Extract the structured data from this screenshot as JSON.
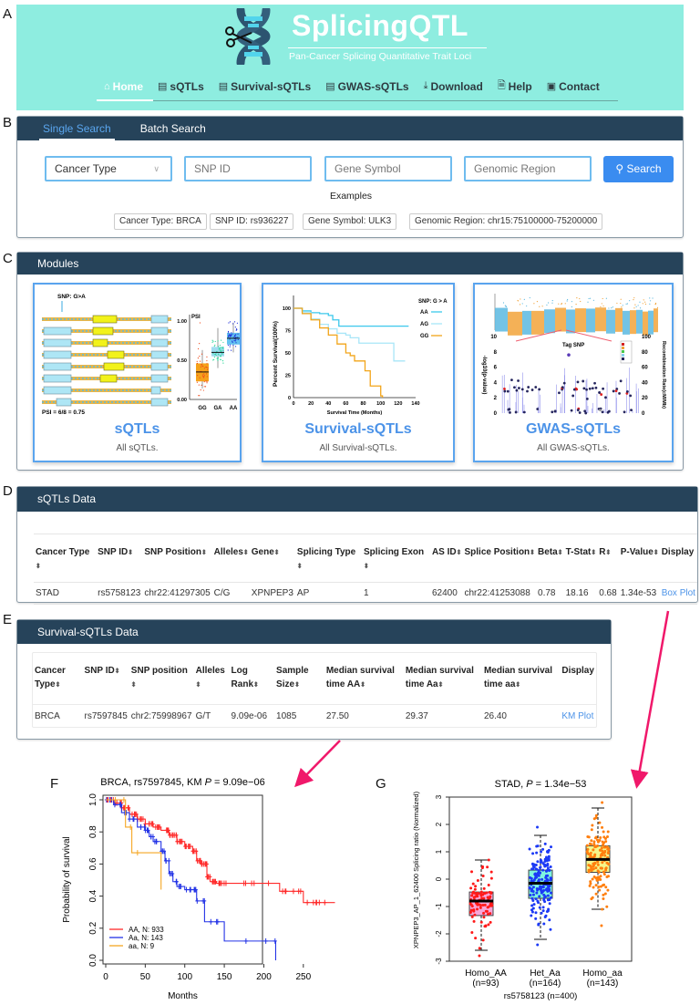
{
  "panel_labels": [
    "A",
    "B",
    "C",
    "D",
    "E",
    "F",
    "G"
  ],
  "header": {
    "title": "SplicingQTL",
    "subtitle": "Pan-Cancer Splicing Quantitative Trait Loci",
    "logo_icon": "dna-scissors-icon",
    "colors": {
      "background": "#8eede0",
      "text": "#ffffff",
      "nav_text": "#2e3a40"
    },
    "nav": [
      {
        "label": "Home",
        "icon": "home-icon",
        "active": true
      },
      {
        "label": "sQTLs",
        "icon": "table-icon",
        "active": false
      },
      {
        "label": "Survival-sQTLs",
        "icon": "table-icon",
        "active": false
      },
      {
        "label": "GWAS-sQTLs",
        "icon": "table-icon",
        "active": false
      },
      {
        "label": "Download",
        "icon": "download-icon",
        "active": false
      },
      {
        "label": "Help",
        "icon": "help-doc-icon",
        "active": false
      },
      {
        "label": "Contact",
        "icon": "contact-book-icon",
        "active": false
      }
    ]
  },
  "search": {
    "tabs": [
      {
        "label": "Single Search",
        "active": true
      },
      {
        "label": "Batch Search",
        "active": false
      }
    ],
    "cancer_type": {
      "value": "Cancer Type"
    },
    "snp_id": {
      "placeholder": "SNP ID"
    },
    "gene_symbol": {
      "placeholder": "Gene Symbol"
    },
    "genomic_region": {
      "placeholder": "Genomic Region"
    },
    "button_label": "Search",
    "examples_label": "Examples",
    "examples": [
      "Cancer Type: BRCA",
      "SNP ID: rs936227",
      "Gene Symbol: ULK3",
      "Genomic Region: chr15:75100000-75200000"
    ],
    "colors": {
      "header_bar": "#26435a",
      "button": "#3a8cf0",
      "field_border": "#6fbcef"
    }
  },
  "modules": {
    "title": "Modules",
    "cards": [
      {
        "title": "sQTLs",
        "description": "All sQTLs.",
        "thumb": {
          "snp_label": "SNP: G>A",
          "psi_formula": "PSI = 6/8 = 0.75",
          "y_label": "PSI",
          "y_ticks": [
            "0.00",
            "0.50",
            "1.00"
          ],
          "groups": [
            "GG",
            "GA",
            "AA"
          ]
        }
      },
      {
        "title": "Survival-sQTLs",
        "description": "All Survival-sQTLs.",
        "thumb": {
          "legend_title": "SNP: G > A",
          "legend": [
            "AA",
            "AG",
            "GG"
          ],
          "y_label": "Percent Survival(100%)",
          "x_label": "Survival Time (Months)",
          "y_ticks": [
            "0",
            "25",
            "50",
            "75",
            "100"
          ],
          "x_ticks": [
            "0",
            "20",
            "40",
            "60",
            "80",
            "100",
            "120",
            "140"
          ]
        }
      },
      {
        "title": "GWAS-sQTLs",
        "description": "All GWAS-sQTLs.",
        "thumb": {
          "annotation": "Tag SNP",
          "y_label": "-log10(p-value)",
          "y2_label": "Recombination Rate(cM/Mb)",
          "y_ticks": [
            "0",
            "2",
            "4",
            "6",
            "8",
            "10"
          ],
          "y2_ticks": [
            "0",
            "20",
            "40",
            "60",
            "80",
            "100"
          ]
        }
      }
    ]
  },
  "sqtls_table": {
    "title": "sQTLs Data",
    "columns": [
      {
        "label": "Cancer Type",
        "sortable": true
      },
      {
        "label": "SNP ID",
        "sortable": true
      },
      {
        "label": "SNP Position",
        "sortable": true
      },
      {
        "label": "Alleles",
        "sortable": true
      },
      {
        "label": "Gene",
        "sortable": true
      },
      {
        "label": "Splicing Type",
        "sortable": true
      },
      {
        "label": "Splicing Exon",
        "sortable": true
      },
      {
        "label": "AS ID",
        "sortable": true
      },
      {
        "label": "Splice Position",
        "sortable": true
      },
      {
        "label": "Beta",
        "sortable": true
      },
      {
        "label": "T-Stat",
        "sortable": true
      },
      {
        "label": "R",
        "sortable": true
      },
      {
        "label": "P-Value",
        "sortable": true
      },
      {
        "label": "Display",
        "sortable": false
      }
    ],
    "rows": [
      [
        "STAD",
        "rs5758123",
        "chr22:41297305",
        "C/G",
        "XPNPEP3",
        "AP",
        "1",
        "62400",
        "chr22:41253088",
        "0.78",
        "18.16",
        "0.68",
        "1.34e-53",
        "Box Plot"
      ]
    ]
  },
  "survival_table": {
    "title": "Survival-sQTLs Data",
    "columns": [
      {
        "label": "Cancer Type",
        "sortable": true
      },
      {
        "label": "SNP ID",
        "sortable": true
      },
      {
        "label": "SNP position",
        "sortable": true
      },
      {
        "label": "Alleles",
        "sortable": true
      },
      {
        "label": "Log Rank",
        "sortable": true
      },
      {
        "label": "Sample Size",
        "sortable": true
      },
      {
        "label": "Median survival time AA",
        "sortable": true
      },
      {
        "label": "Median survival time Aa",
        "sortable": true
      },
      {
        "label": "Median survival time aa",
        "sortable": true
      },
      {
        "label": "Display",
        "sortable": false
      }
    ],
    "rows": [
      [
        "BRCA",
        "rs7597845",
        "chr2:75998967",
        "G/T",
        "9.09e-06",
        "1085",
        "27.50",
        "29.37",
        "26.40",
        "KM Plot"
      ]
    ]
  },
  "annotation_arrow_color": "#f0186a",
  "chart_data": [
    {
      "type": "line",
      "subtype": "kaplan-meier",
      "title": "BRCA, rs7597845, KM P = 9.09e−06",
      "title_prefix": "BRCA, rs7597845, KM ",
      "title_p": "P",
      "title_suffix": " = 9.09e−06",
      "xlabel": "Months",
      "ylabel": "Probability of survival",
      "xlim": [
        0,
        290
      ],
      "ylim": [
        0,
        1.0
      ],
      "x_ticks": [
        0,
        50,
        100,
        150,
        200,
        250
      ],
      "y_ticks": [
        0.0,
        0.2,
        0.4,
        0.6,
        0.8,
        1.0
      ],
      "y_tick_labels": [
        "0.0",
        "0.2",
        "0.4",
        "0.6",
        "0.8",
        "1.0"
      ],
      "legend_position": "bottom-left",
      "series": [
        {
          "name": "AA, N: 933",
          "color": "#ff2a2a",
          "x": [
            0,
            10,
            20,
            30,
            40,
            50,
            60,
            70,
            80,
            90,
            100,
            110,
            115,
            120,
            128,
            132,
            140,
            150,
            220,
            250,
            290
          ],
          "y": [
            1.0,
            0.98,
            0.95,
            0.91,
            0.88,
            0.85,
            0.83,
            0.81,
            0.78,
            0.74,
            0.71,
            0.68,
            0.62,
            0.6,
            0.52,
            0.49,
            0.48,
            0.48,
            0.43,
            0.36,
            0.36
          ]
        },
        {
          "name": "Aa, N: 143",
          "color": "#2232e6",
          "x": [
            0,
            10,
            20,
            30,
            40,
            50,
            55,
            60,
            70,
            75,
            80,
            85,
            90,
            100,
            110,
            115,
            125,
            150,
            215
          ],
          "y": [
            1.0,
            0.97,
            0.92,
            0.88,
            0.83,
            0.81,
            0.77,
            0.74,
            0.68,
            0.62,
            0.54,
            0.49,
            0.46,
            0.44,
            0.44,
            0.37,
            0.24,
            0.12,
            0.0
          ]
        },
        {
          "name": "aa, N: 9",
          "color": "#f5a623",
          "x": [
            0,
            20,
            25,
            33,
            70
          ],
          "y": [
            1.0,
            1.0,
            0.83,
            0.67,
            0.44
          ]
        }
      ]
    },
    {
      "type": "box",
      "title": "STAD, P = 1.34e−53",
      "title_prefix": "STAD, ",
      "title_p": "P",
      "title_suffix": " = 1.34e−53",
      "xlabel": "rs5758123 (n=400)",
      "ylabel": "XPNPEP3_AP_1_62400 Splicing ratio (Normalized)",
      "ylim": [
        -3,
        3
      ],
      "y_ticks": [
        -3,
        -2,
        -1,
        0,
        1,
        2,
        3
      ],
      "categories": [
        "Homo_AA",
        "Het_Aa",
        "Homo_aa"
      ],
      "category_counts": [
        "(n=93)",
        "(n=164)",
        "(n=143)"
      ],
      "series": [
        {
          "name": "Homo_AA",
          "n": 93,
          "min": -2.6,
          "q1": -1.33,
          "median": -0.8,
          "q3": -0.47,
          "max": 0.7,
          "outliers": [
            -2.8
          ],
          "box_color": "#f7a6d9",
          "point_color": "#ff1a1a"
        },
        {
          "name": "Het_Aa",
          "n": 164,
          "min": -2.2,
          "q1": -0.7,
          "median": -0.15,
          "q3": 0.33,
          "max": 1.6,
          "outliers": [
            1.9,
            -2.4
          ],
          "box_color": "#7ff5e0",
          "point_color": "#1c3af5"
        },
        {
          "name": "Homo_aa",
          "n": 143,
          "min": -1.1,
          "q1": 0.25,
          "median": 0.72,
          "q3": 1.22,
          "max": 2.6,
          "outliers": [
            2.8,
            -1.7
          ],
          "box_color": "#f5f58a",
          "point_color": "#ff7f0e"
        }
      ]
    }
  ]
}
